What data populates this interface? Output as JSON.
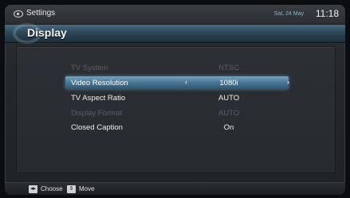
{
  "window": {
    "title": "Settings",
    "date": "Sat, 24 May",
    "time": "11:18"
  },
  "header": {
    "title": "Display"
  },
  "rows": [
    {
      "label": "TV System",
      "value": "NTSC",
      "state": "disabled"
    },
    {
      "label": "Video Resolution",
      "value": "1080i",
      "state": "selected",
      "left_arrow": "‹",
      "right_arrow": "›"
    },
    {
      "label": "TV Aspect Ratio",
      "value": "AUTO",
      "state": "normal"
    },
    {
      "label": "Display Format",
      "value": "AUTO",
      "state": "disabled"
    },
    {
      "label": "Closed Caption",
      "value": "On",
      "state": "normal"
    }
  ],
  "footer": {
    "choose_label": "Choose",
    "move_label": "Move"
  },
  "icons": {
    "settings": "disc-icon",
    "choose": "left-right-arrows-icon",
    "move": "up-down-arrows-icon"
  },
  "colors": {
    "accent": "#4d7896",
    "disabled_text": "#5a5f66",
    "text": "#f0f0f0"
  }
}
